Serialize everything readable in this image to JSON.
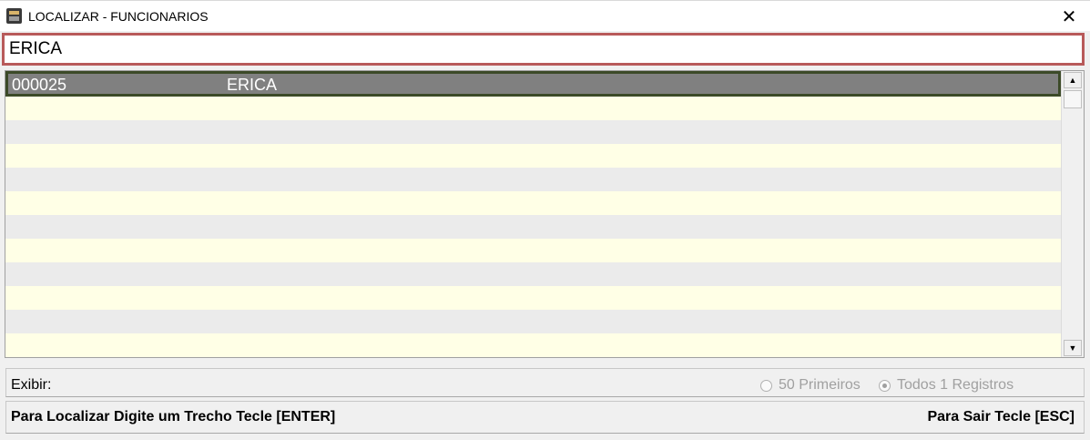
{
  "window": {
    "title": "LOCALIZAR - FUNCIONARIOS",
    "close_glyph": "✕"
  },
  "search": {
    "value": "ERICA"
  },
  "results": {
    "rows": [
      {
        "code": "000025",
        "name": "ERICA",
        "selected": true
      }
    ]
  },
  "scrollbar": {
    "up_glyph": "▲",
    "down_glyph": "▼"
  },
  "filter": {
    "label": "Exibir:",
    "option_first": "50 Primeiros",
    "option_all": "Todos 1 Registros",
    "selected": "all"
  },
  "status": {
    "left": "Para Localizar Digite um Trecho Tecle [ENTER]",
    "right": "Para Sair Tecle [ESC]"
  },
  "colors": {
    "search_border": "#b85a5a",
    "selected_row": "#808080",
    "selected_border": "#3c4a28",
    "row_alt_yellow": "#ffffe6",
    "row_alt_gray": "#ebebeb"
  }
}
